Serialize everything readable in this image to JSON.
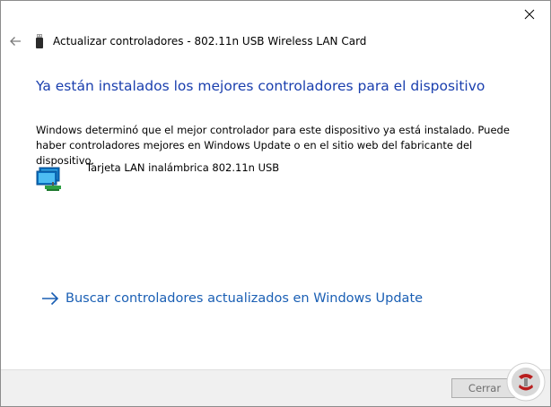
{
  "window": {
    "title": "Actualizar controladores - 802.11n USB Wireless LAN Card",
    "close_icon": "close-icon",
    "back_icon": "back-arrow-icon",
    "title_icon": "usb-device-icon"
  },
  "main": {
    "heading": "Ya están instalados los mejores controladores para el dispositivo",
    "description": "Windows determinó que el mejor controlador para este dispositivo ya está instalado. Puede haber controladores mejores en Windows Update o en el sitio web del fabricante del dispositivo.",
    "device": {
      "icon": "network-adapter-icon",
      "name": "Tarjeta LAN inalámbrica 802.11n USB"
    },
    "update_link": {
      "icon": "arrow-right-icon",
      "label": "Buscar controladores actualizados en Windows Update"
    }
  },
  "footer": {
    "cancel_label": "Cerrar"
  },
  "colors": {
    "heading": "#1a3fae",
    "link": "#1a5fb4",
    "footer_bg": "#f0f0f0"
  },
  "watermark": {
    "icon": "brand-logo-icon"
  }
}
